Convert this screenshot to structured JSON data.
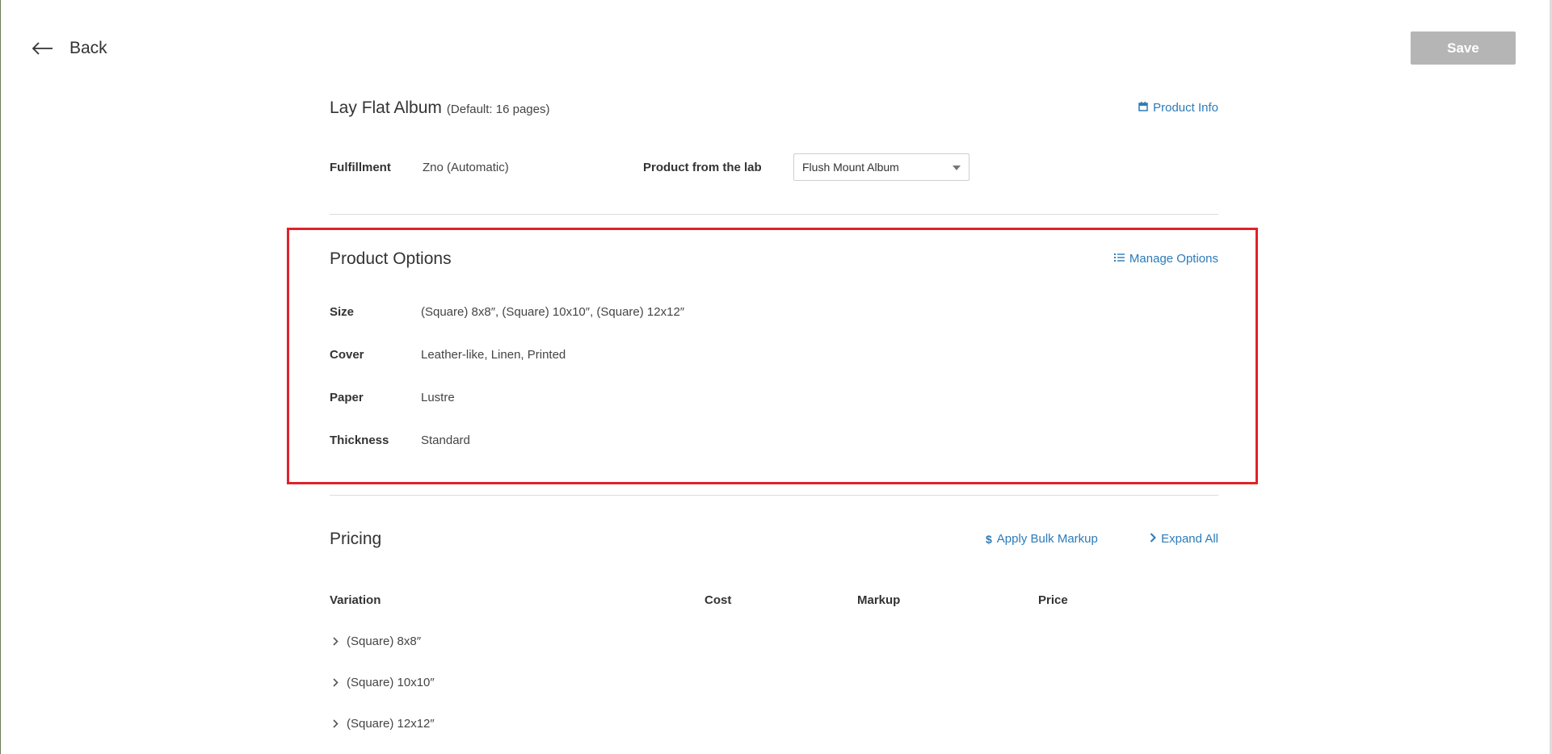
{
  "nav": {
    "back_label": "Back"
  },
  "toolbar": {
    "save_label": "Save"
  },
  "product": {
    "name": "Lay Flat Album",
    "default_note": "(Default:  16 pages)",
    "info_link": "Product Info"
  },
  "fulfillment": {
    "label": "Fulfillment",
    "value": "Zno (Automatic)",
    "lab_label": "Product from the lab",
    "lab_selected": "Flush Mount Album"
  },
  "options": {
    "title": "Product Options",
    "manage_link": "Manage Options",
    "rows": [
      {
        "label": "Size",
        "value": "(Square) 8x8″, (Square) 10x10″, (Square) 12x12″"
      },
      {
        "label": "Cover",
        "value": "Leather-like, Linen, Printed"
      },
      {
        "label": "Paper",
        "value": "Lustre"
      },
      {
        "label": "Thickness",
        "value": "Standard"
      }
    ]
  },
  "pricing": {
    "title": "Pricing",
    "bulk_markup_link": "Apply Bulk Markup",
    "expand_all_link": "Expand All",
    "columns": [
      "Variation",
      "Cost",
      "Markup",
      "Price"
    ],
    "variations": [
      "(Square) 8x8″",
      "(Square) 10x10″",
      "(Square) 12x12″"
    ]
  },
  "colors": {
    "link": "#2b7bb9",
    "highlight_border": "#e0212a",
    "save_disabled_bg": "#b5b5b5"
  },
  "icons": {
    "back": "arrow-left-icon",
    "product_info": "calendar-icon",
    "manage_options": "list-icon",
    "bulk_markup": "dollar-icon",
    "expand_all": "chevron-right-icon",
    "row_expand": "chevron-right-icon"
  }
}
